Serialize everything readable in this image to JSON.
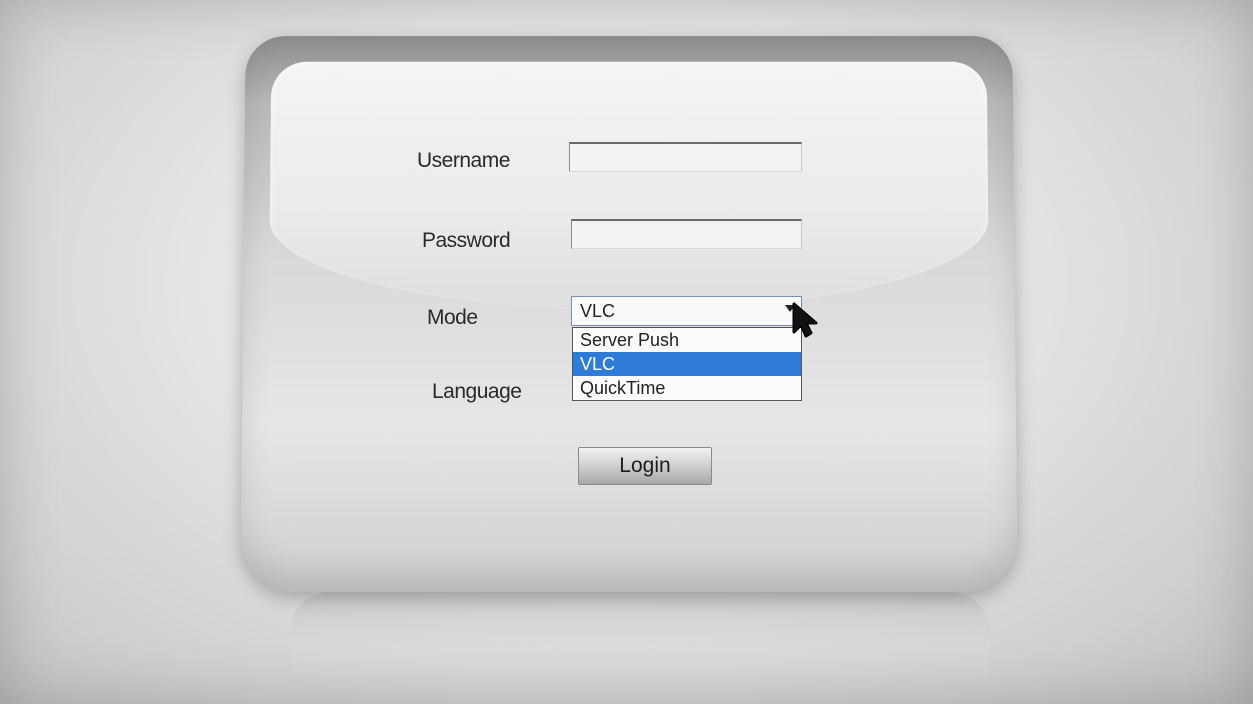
{
  "form": {
    "username_label": "Username",
    "username_value": "",
    "password_label": "Password",
    "password_value": "",
    "mode_label": "Mode",
    "mode_selected": "VLC",
    "mode_options": [
      "Server Push",
      "VLC",
      "QuickTime"
    ],
    "language_label": "Language",
    "login_label": "Login"
  },
  "colors": {
    "selected_option_bg": "#2f7bd8",
    "select_border": "#7a90b8"
  },
  "icons": {
    "dropdown": "chevron-down-icon",
    "pointer": "mouse-cursor-icon"
  }
}
